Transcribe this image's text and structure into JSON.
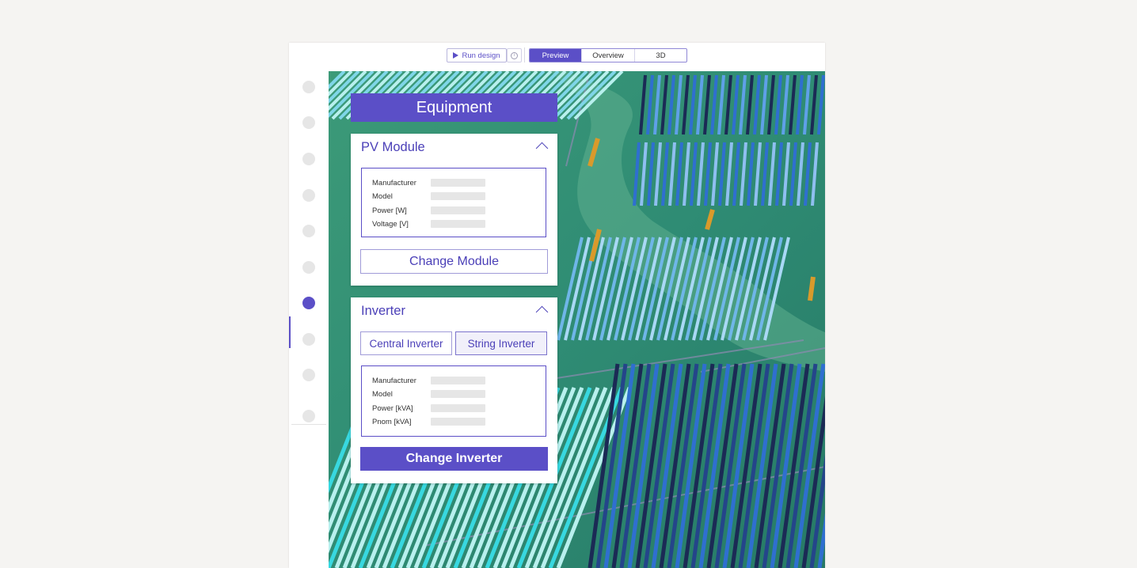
{
  "toolbar": {
    "run_label": "Run design",
    "tabs": [
      {
        "label": "Preview",
        "active": true
      },
      {
        "label": "Overview",
        "active": false
      },
      {
        "label": "3D",
        "active": false
      }
    ]
  },
  "sidebar": {
    "items": [
      {
        "active": false
      },
      {
        "active": false
      },
      {
        "active": false
      },
      {
        "active": false
      },
      {
        "active": false
      },
      {
        "active": false
      },
      {
        "active": true
      },
      {
        "active": false
      },
      {
        "active": false
      },
      {
        "active": false
      }
    ]
  },
  "panel": {
    "title": "Equipment",
    "pv_module": {
      "heading": "PV Module",
      "fields": [
        "Manufacturer",
        "Model",
        "Power [W]",
        "Voltage [V]"
      ],
      "change_label": "Change Module"
    },
    "inverter": {
      "heading": "Inverter",
      "central_label": "Central Inverter",
      "string_label": "String Inverter",
      "selected_type": "String Inverter",
      "fields": [
        "Manufacturer",
        "Model",
        "Power [kVA]",
        "Pnom [kVA]"
      ],
      "change_label": "Change Inverter"
    }
  },
  "colors": {
    "accent": "#5b4fc7",
    "terrain": "#2f8a72",
    "panel_light": "#b8f0ee",
    "panel_cyan": "#38d8e0",
    "panel_blue": "#2f6fd0",
    "panel_dark": "#1b2a55",
    "panel_orange": "#d99a2b"
  }
}
